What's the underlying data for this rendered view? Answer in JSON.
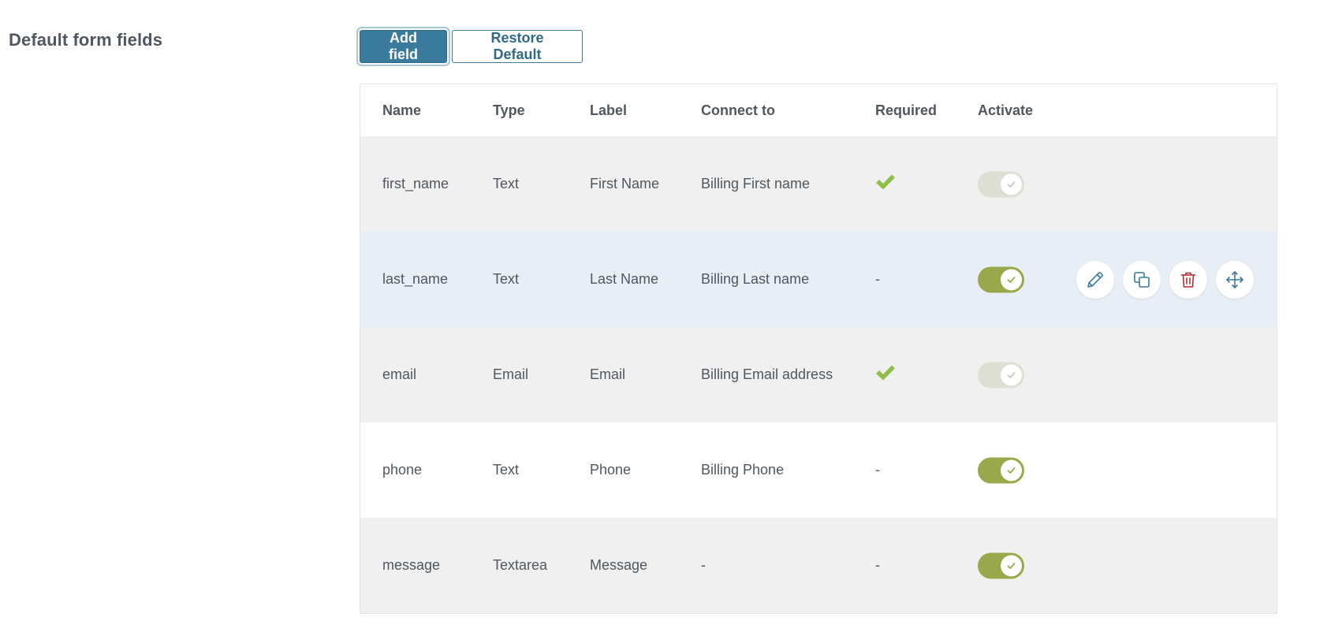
{
  "section": {
    "title": "Default form fields"
  },
  "toolbar": {
    "add_label": "Add field",
    "restore_label": "Restore Default"
  },
  "table": {
    "headers": {
      "name": "Name",
      "type": "Type",
      "label": "Label",
      "connect_to": "Connect to",
      "required": "Required",
      "activate": "Activate"
    },
    "rows": [
      {
        "name": "first_name",
        "type": "Text",
        "label": "First Name",
        "connect_to": "Billing First name",
        "required": "check-icon",
        "required_text": "",
        "activate": "on-disabled"
      },
      {
        "name": "last_name",
        "type": "Text",
        "label": "Last Name",
        "connect_to": "Billing Last name",
        "required": "",
        "required_text": "-",
        "activate": "on"
      },
      {
        "name": "email",
        "type": "Email",
        "label": "Email",
        "connect_to": "Billing Email address",
        "required": "check-icon",
        "required_text": "",
        "activate": "on-disabled"
      },
      {
        "name": "phone",
        "type": "Text",
        "label": "Phone",
        "connect_to": "Billing Phone",
        "required": "",
        "required_text": "-",
        "activate": "on"
      },
      {
        "name": "message",
        "type": "Textarea",
        "label": "Message",
        "connect_to": "-",
        "required": "",
        "required_text": "-",
        "activate": "on"
      }
    ]
  },
  "row_actions": [
    "edit-icon",
    "duplicate-icon",
    "delete-icon",
    "move-icon"
  ],
  "colors": {
    "primary": "#3a7a9c",
    "toggle_on": "#98a84a",
    "toggle_disabled": "#dcdfd2",
    "check": "#8fbf4a",
    "delete": "#b32d2e",
    "row_hover": "#e8eef5",
    "row_gray": "#f0f0f0"
  }
}
